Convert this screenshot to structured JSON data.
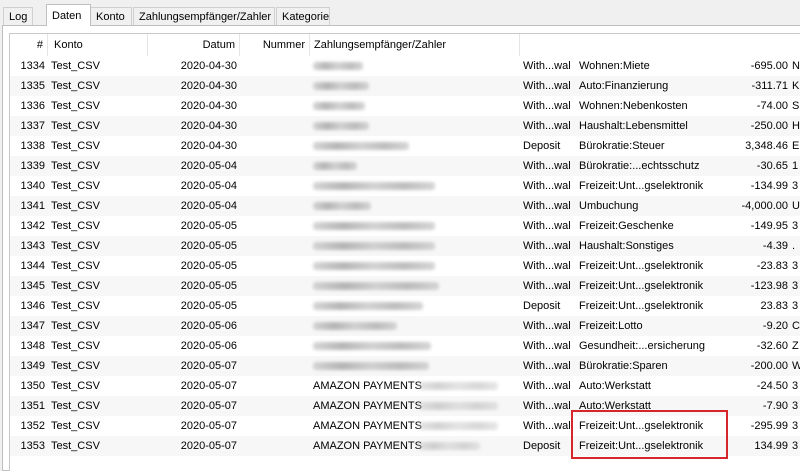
{
  "tabs": [
    {
      "label": "Log",
      "active": false
    },
    {
      "label": "Daten",
      "active": true
    },
    {
      "label": "Konto",
      "active": false
    },
    {
      "label": "Zahlungsempfänger/Zahler",
      "active": false
    },
    {
      "label": "Kategorie",
      "active": false
    }
  ],
  "columns": {
    "num": "#",
    "account": "Konto",
    "date": "Datum",
    "number": "Nummer",
    "payee": "Zahlungsempfänger/Zahler"
  },
  "rows": [
    {
      "num": "1334",
      "account": "Test_CSV",
      "date": "2020-04-30",
      "payee": "",
      "type": "With...wal",
      "category": "Wohnen:Miete",
      "amount": "-695.00",
      "extra": "N"
    },
    {
      "num": "1335",
      "account": "Test_CSV",
      "date": "2020-04-30",
      "payee": "",
      "type": "With...wal",
      "category": "Auto:Finanzierung",
      "amount": "-311.71",
      "extra": "K"
    },
    {
      "num": "1336",
      "account": "Test_CSV",
      "date": "2020-04-30",
      "payee": "",
      "type": "With...wal",
      "category": "Wohnen:Nebenkosten",
      "amount": "-74.00",
      "extra": "S"
    },
    {
      "num": "1337",
      "account": "Test_CSV",
      "date": "2020-04-30",
      "payee": "",
      "type": "With...wal",
      "category": "Haushalt:Lebensmittel",
      "amount": "-250.00",
      "extra": "H"
    },
    {
      "num": "1338",
      "account": "Test_CSV",
      "date": "2020-04-30",
      "payee": "",
      "type": "Deposit",
      "category": "Bürokratie:Steuer",
      "amount": "3,348.46",
      "extra": "E"
    },
    {
      "num": "1339",
      "account": "Test_CSV",
      "date": "2020-05-04",
      "payee": "",
      "type": "With...wal",
      "category": "Bürokratie:...echtsschutz",
      "amount": "-30.65",
      "extra": "1"
    },
    {
      "num": "1340",
      "account": "Test_CSV",
      "date": "2020-05-04",
      "payee": "",
      "type": "With...wal",
      "category": "Freizeit:Unt...gselektronik",
      "amount": "-134.99",
      "extra": "3"
    },
    {
      "num": "1341",
      "account": "Test_CSV",
      "date": "2020-05-04",
      "payee": "",
      "type": "With...wal",
      "category": "Umbuchung",
      "amount": "-4,000.00",
      "extra": "U"
    },
    {
      "num": "1342",
      "account": "Test_CSV",
      "date": "2020-05-05",
      "payee": "",
      "type": "With...wal",
      "category": "Freizeit:Geschenke",
      "amount": "-149.95",
      "extra": "3"
    },
    {
      "num": "1343",
      "account": "Test_CSV",
      "date": "2020-05-05",
      "payee": "",
      "type": "With...wal",
      "category": "Haushalt:Sonstiges",
      "amount": "-4.39",
      "extra": "."
    },
    {
      "num": "1344",
      "account": "Test_CSV",
      "date": "2020-05-05",
      "payee": "",
      "type": "With...wal",
      "category": "Freizeit:Unt...gselektronik",
      "amount": "-23.83",
      "extra": "3"
    },
    {
      "num": "1345",
      "account": "Test_CSV",
      "date": "2020-05-05",
      "payee": "",
      "type": "With...wal",
      "category": "Freizeit:Unt...gselektronik",
      "amount": "-123.98",
      "extra": "3"
    },
    {
      "num": "1346",
      "account": "Test_CSV",
      "date": "2020-05-05",
      "payee": "",
      "type": "Deposit",
      "category": "Freizeit:Unt...gselektronik",
      "amount": "23.83",
      "extra": "3"
    },
    {
      "num": "1347",
      "account": "Test_CSV",
      "date": "2020-05-06",
      "payee": "",
      "type": "With...wal",
      "category": "Freizeit:Lotto",
      "amount": "-9.20",
      "extra": "C"
    },
    {
      "num": "1348",
      "account": "Test_CSV",
      "date": "2020-05-06",
      "payee": "",
      "type": "With...wal",
      "category": "Gesundheit:...ersicherung",
      "amount": "-32.60",
      "extra": "Z"
    },
    {
      "num": "1349",
      "account": "Test_CSV",
      "date": "2020-05-07",
      "payee": "",
      "type": "With...wal",
      "category": "Bürokratie:Sparen",
      "amount": "-200.00",
      "extra": "W"
    },
    {
      "num": "1350",
      "account": "Test_CSV",
      "date": "2020-05-07",
      "payee": "AMAZON PAYMENTS",
      "type": "With...wal",
      "category": "Auto:Werkstatt",
      "amount": "-24.50",
      "extra": "3"
    },
    {
      "num": "1351",
      "account": "Test_CSV",
      "date": "2020-05-07",
      "payee": "AMAZON PAYMENTS",
      "type": "With...wal",
      "category": "Auto:Werkstatt",
      "amount": "-7.90",
      "extra": "3"
    },
    {
      "num": "1352",
      "account": "Test_CSV",
      "date": "2020-05-07",
      "payee": "AMAZON PAYMENTS",
      "type": "With...wal",
      "category": "Freizeit:Unt...gselektronik",
      "amount": "-295.99",
      "extra": "3"
    },
    {
      "num": "1353",
      "account": "Test_CSV",
      "date": "2020-05-07",
      "payee": "AMAZON PAYMENTS",
      "type": "Deposit",
      "category": "Freizeit:Unt...gselektronik",
      "amount": "134.99",
      "extra": "3"
    }
  ],
  "highlight_color": "#d4262b"
}
